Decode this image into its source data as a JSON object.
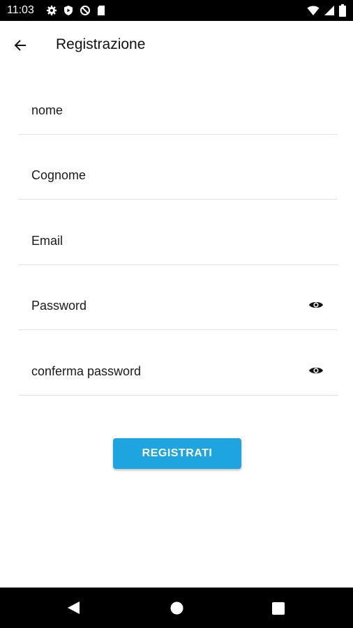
{
  "status_bar": {
    "time": "11:03",
    "left_icons": [
      "gear-icon",
      "shield-icon",
      "data-saver-icon",
      "sd-card-icon"
    ],
    "right_icons": [
      "wifi-icon",
      "signal-icon",
      "battery-icon"
    ]
  },
  "app_bar": {
    "title": "Registrazione",
    "back_icon": "arrow-left-icon"
  },
  "form": {
    "fields": [
      {
        "label": "nome"
      },
      {
        "label": "Cognome"
      },
      {
        "label": "Email"
      },
      {
        "label": "Password",
        "icon": "eye-icon"
      },
      {
        "label": "conferma password",
        "icon": "eye-icon"
      }
    ],
    "submit_label": "REGISTRATI"
  },
  "nav_bar": {
    "buttons": [
      "back-triangle-icon",
      "home-circle-icon",
      "recents-square-icon"
    ]
  },
  "colors": {
    "accent": "#1ea5e0",
    "status_bar": "#000000",
    "divider": "#e2e2e2"
  }
}
